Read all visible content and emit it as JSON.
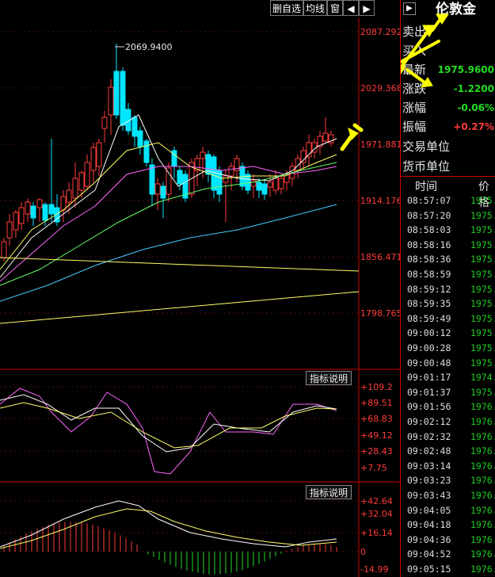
{
  "toolbar": {
    "buttons": [
      "删自选",
      "均线",
      "窗"
    ],
    "arrow_left": "◀",
    "arrow_right": "▶"
  },
  "price_axis": [
    "2087.292",
    "2029.368",
    "1971.881",
    "1914.176",
    "1856.471",
    "1798.765"
  ],
  "high_label": "2069.9400",
  "panel1": {
    "button": "指标说明",
    "axis": [
      "+109.2",
      "+89.51",
      "+68.83",
      "+49.12",
      "+28.43",
      "+7.75"
    ]
  },
  "panel2": {
    "button": "指标说明",
    "axis": [
      "+42.64",
      "+32.04",
      "+16.14",
      "0",
      "-14.99"
    ]
  },
  "quote": {
    "symbol": "伦敦金",
    "rows": [
      {
        "label": "卖出",
        "value": ""
      },
      {
        "label": "买入",
        "value": ""
      },
      {
        "label": "最新",
        "value": "1975.9600"
      },
      {
        "label": "涨跌",
        "value": "-1.2200"
      },
      {
        "label": "涨幅",
        "value": "-0.06%"
      },
      {
        "label": "振幅",
        "value": "+0.27%"
      },
      {
        "label": "交易单位",
        "value": ""
      },
      {
        "label": "货币单位",
        "value": ""
      }
    ],
    "value_colors": [
      "#ff3b3b",
      "#ff3b3b",
      "#22dd22",
      "#22dd22",
      "#22dd22",
      "#ff3b3b",
      "#ffffff",
      "#ffffff"
    ]
  },
  "ticks": {
    "headers": [
      "时间",
      "价格"
    ],
    "rows": [
      {
        "time": "08:57:07",
        "price": "1975."
      },
      {
        "time": "08:57:20",
        "price": "1975."
      },
      {
        "time": "08:58:03",
        "price": "1975."
      },
      {
        "time": "08:58:16",
        "price": "1975."
      },
      {
        "time": "08:58:36",
        "price": "1975."
      },
      {
        "time": "08:58:59",
        "price": "1975."
      },
      {
        "time": "08:59:12",
        "price": "1975."
      },
      {
        "time": "08:59:35",
        "price": "1975."
      },
      {
        "time": "08:59:49",
        "price": "1975."
      },
      {
        "time": "09:00:12",
        "price": "1975."
      },
      {
        "time": "09:00:28",
        "price": "1975."
      },
      {
        "time": "09:00:48",
        "price": "1975."
      },
      {
        "time": "09:01:17",
        "price": "1974."
      },
      {
        "time": "09:01:37",
        "price": "1975."
      },
      {
        "time": "09:01:56",
        "price": "1976."
      },
      {
        "time": "09:02:12",
        "price": "1976."
      },
      {
        "time": "09:02:32",
        "price": "1976."
      },
      {
        "time": "09:02:48",
        "price": "1976."
      },
      {
        "time": "09:03:14",
        "price": "1976."
      },
      {
        "time": "09:03:23",
        "price": "1976."
      },
      {
        "time": "09:03:43",
        "price": "1976."
      },
      {
        "time": "09:04:05",
        "price": "1976."
      },
      {
        "time": "09:04:18",
        "price": "1976."
      },
      {
        "time": "09:04:36",
        "price": "1976."
      },
      {
        "time": "09:04:52",
        "price": "1976."
      },
      {
        "time": "09:05:15",
        "price": "1976."
      }
    ]
  },
  "colors": {
    "up": "#ff3b3b",
    "down": "#00e5ff",
    "axis": "#cc0000",
    "annotation": "#ffff00"
  }
}
